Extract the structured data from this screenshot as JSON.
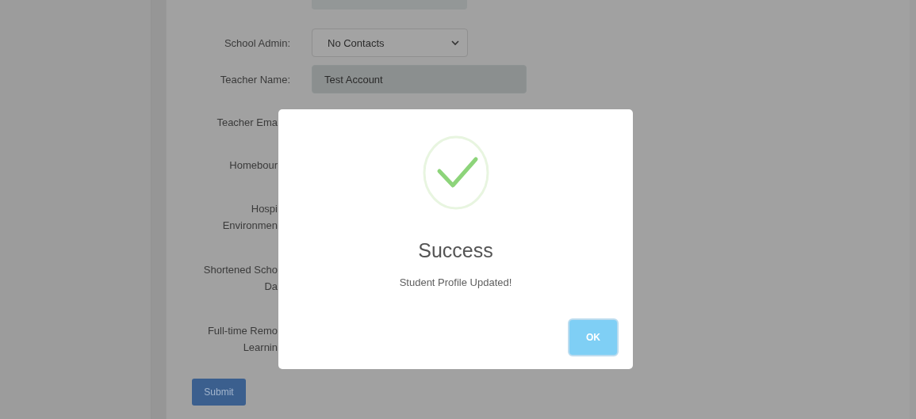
{
  "form": {
    "rows": [
      {
        "label_lines": [
          "School Admin:"
        ],
        "field": {
          "kind": "select",
          "value": "No Contacts"
        }
      },
      {
        "label_lines": [
          "Teacher Name:"
        ],
        "field": {
          "kind": "readonly",
          "value": "Test Account"
        }
      },
      {
        "label_lines": [
          "Teacher Ema"
        ]
      },
      {
        "label_lines": [
          "Homebour"
        ]
      },
      {
        "label_lines": [
          "Hospi",
          "Environmen"
        ]
      },
      {
        "label_lines": [
          "Shortened Scho",
          "Da"
        ]
      },
      {
        "label_lines": [
          "Full-time Remo",
          "Learnin"
        ]
      }
    ],
    "submit": "Submit"
  },
  "dialog": {
    "kind": "success",
    "title": "Success",
    "message": "Student Profile Updated!",
    "ok": "OK"
  }
}
